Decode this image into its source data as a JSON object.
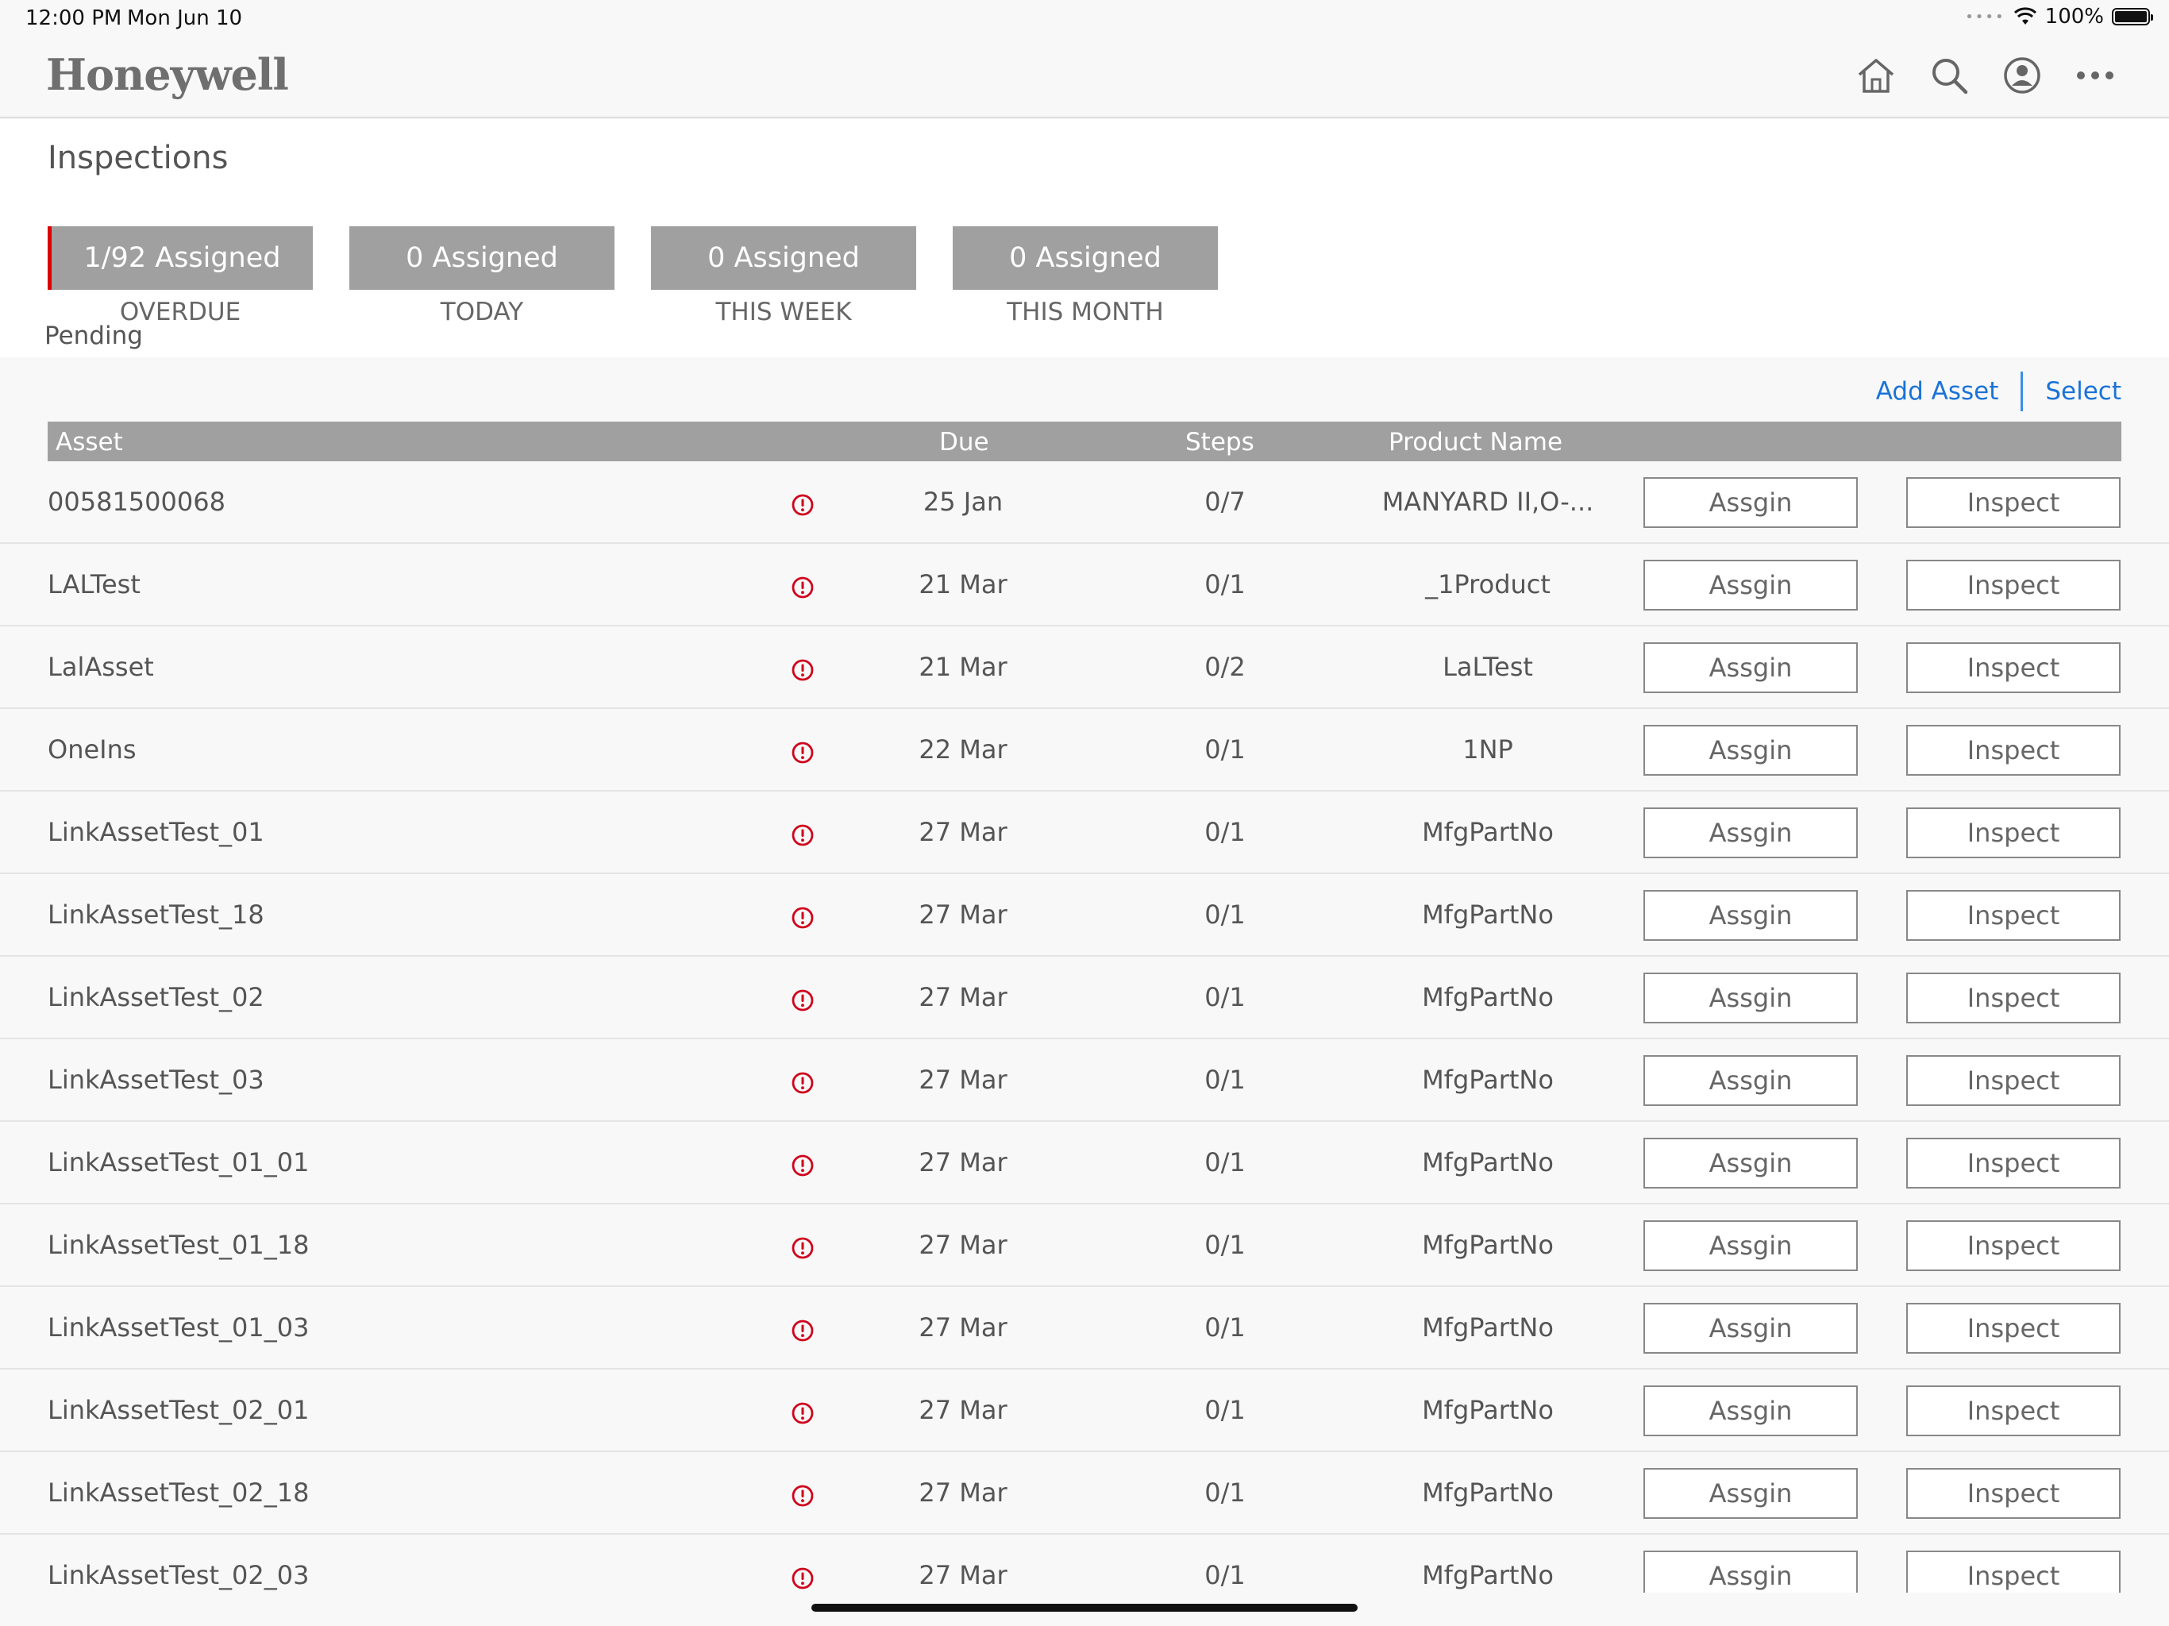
{
  "status_bar": {
    "time": "12:00 PM",
    "date": "Mon Jun 10",
    "battery": "100%"
  },
  "header": {
    "logo": "Honeywell"
  },
  "page": {
    "title": "Inspections",
    "pending_label": "Pending"
  },
  "summary_cards": [
    {
      "value": "1/92 Assigned",
      "caption": "OVERDUE"
    },
    {
      "value": "0 Assigned",
      "caption": "TODAY"
    },
    {
      "value": "0 Assigned",
      "caption": "THIS WEEK"
    },
    {
      "value": "0 Assigned",
      "caption": "THIS MONTH"
    }
  ],
  "actions": {
    "add_asset": "Add Asset",
    "select": "Select"
  },
  "table": {
    "headers": {
      "asset": "Asset",
      "due": "Due",
      "steps": "Steps",
      "product": "Product Name"
    },
    "rows": [
      {
        "asset": "00581500068",
        "due": "25 Jan",
        "steps": "0/7",
        "product": "MANYARD II,O-...",
        "assign": "Assgin",
        "inspect": "Inspect"
      },
      {
        "asset": "LALTest",
        "due": "21 Mar",
        "steps": "0/1",
        "product": "_1Product",
        "assign": "Assgin",
        "inspect": "Inspect"
      },
      {
        "asset": "LalAsset",
        "due": "21 Mar",
        "steps": "0/2",
        "product": "LaLTest",
        "assign": "Assgin",
        "inspect": "Inspect"
      },
      {
        "asset": "OneIns",
        "due": "22 Mar",
        "steps": "0/1",
        "product": "1NP",
        "assign": "Assgin",
        "inspect": "Inspect"
      },
      {
        "asset": "LinkAssetTest_01",
        "due": "27 Mar",
        "steps": "0/1",
        "product": "MfgPartNo",
        "assign": "Assgin",
        "inspect": "Inspect"
      },
      {
        "asset": "LinkAssetTest_18",
        "due": "27 Mar",
        "steps": "0/1",
        "product": "MfgPartNo",
        "assign": "Assgin",
        "inspect": "Inspect"
      },
      {
        "asset": "LinkAssetTest_02",
        "due": "27 Mar",
        "steps": "0/1",
        "product": "MfgPartNo",
        "assign": "Assgin",
        "inspect": "Inspect"
      },
      {
        "asset": "LinkAssetTest_03",
        "due": "27 Mar",
        "steps": "0/1",
        "product": "MfgPartNo",
        "assign": "Assgin",
        "inspect": "Inspect"
      },
      {
        "asset": "LinkAssetTest_01_01",
        "due": "27 Mar",
        "steps": "0/1",
        "product": "MfgPartNo",
        "assign": "Assgin",
        "inspect": "Inspect"
      },
      {
        "asset": "LinkAssetTest_01_18",
        "due": "27 Mar",
        "steps": "0/1",
        "product": "MfgPartNo",
        "assign": "Assgin",
        "inspect": "Inspect"
      },
      {
        "asset": "LinkAssetTest_01_03",
        "due": "27 Mar",
        "steps": "0/1",
        "product": "MfgPartNo",
        "assign": "Assgin",
        "inspect": "Inspect"
      },
      {
        "asset": "LinkAssetTest_02_01",
        "due": "27 Mar",
        "steps": "0/1",
        "product": "MfgPartNo",
        "assign": "Assgin",
        "inspect": "Inspect"
      },
      {
        "asset": "LinkAssetTest_02_18",
        "due": "27 Mar",
        "steps": "0/1",
        "product": "MfgPartNo",
        "assign": "Assgin",
        "inspect": "Inspect"
      },
      {
        "asset": "LinkAssetTest_02_03",
        "due": "27 Mar",
        "steps": "0/1",
        "product": "MfgPartNo",
        "assign": "Assgin",
        "inspect": "Inspect"
      }
    ]
  },
  "colors": {
    "accent_link": "#1a73d8",
    "warning": "#d0021b",
    "card_bg": "#a0a0a0",
    "overdue_marker": "#dd0000"
  },
  "icons": {
    "header": [
      "home-icon",
      "search-icon",
      "user-account-icon",
      "more-icon"
    ],
    "row_warning": "exclamation-circle-icon"
  }
}
